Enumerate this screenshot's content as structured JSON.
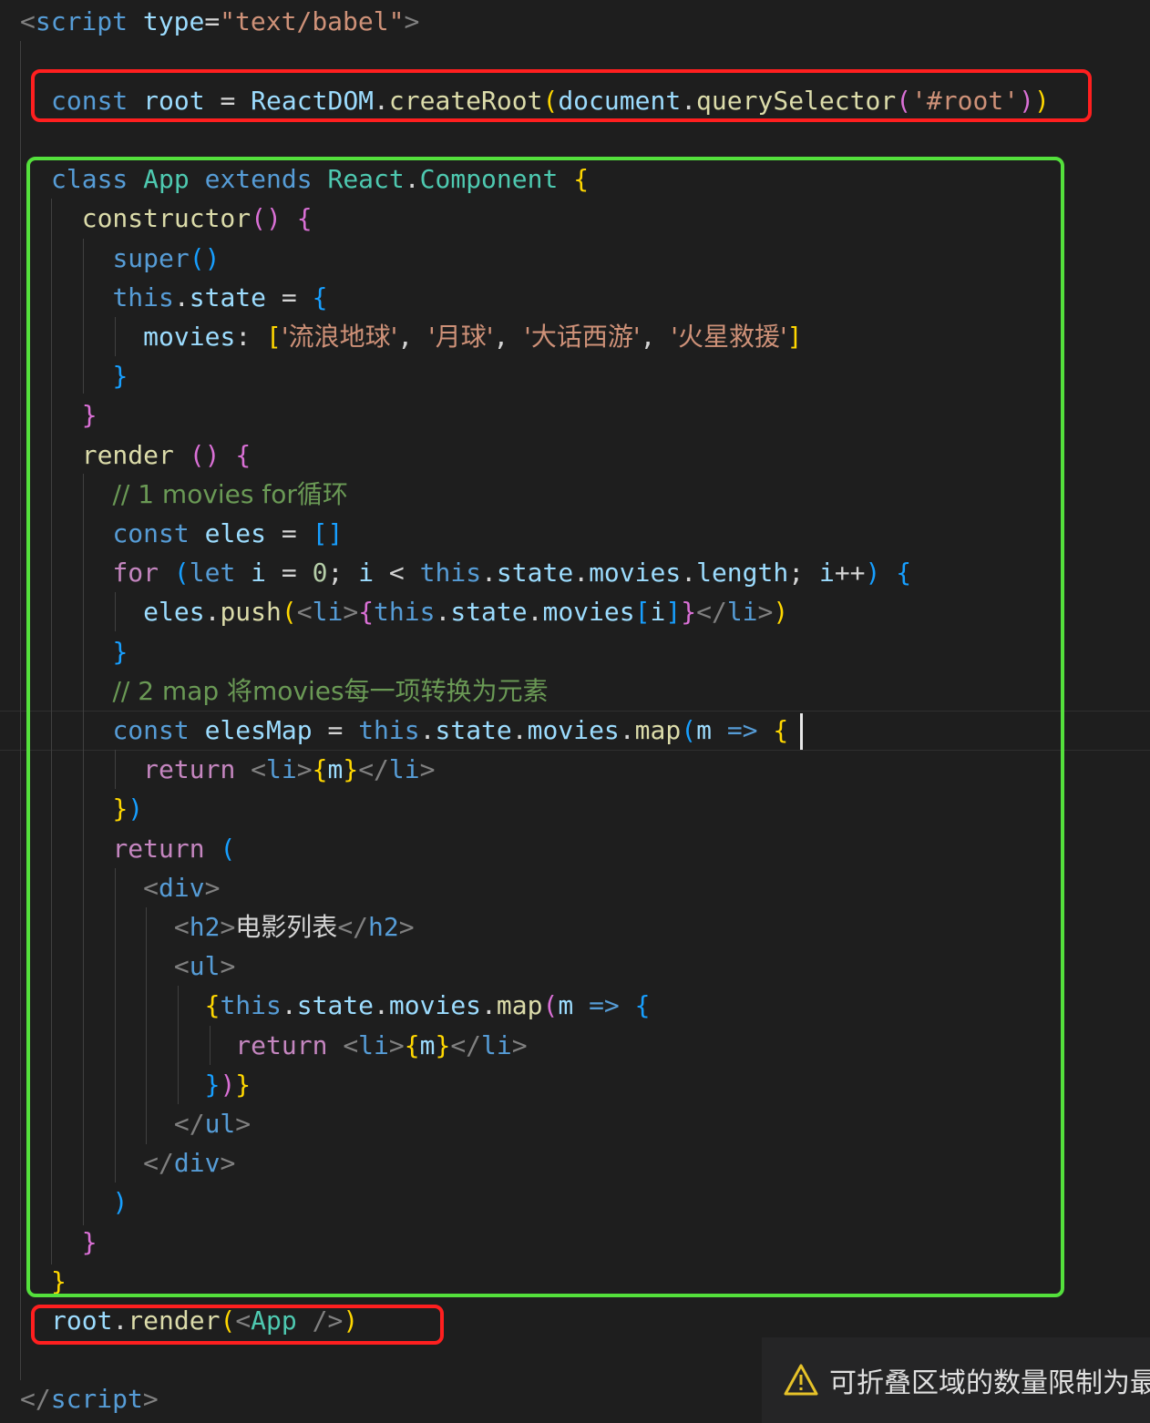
{
  "code": {
    "line1": [
      [
        "t-tag",
        "<"
      ],
      [
        "t-tagn",
        "script"
      ],
      [
        "t-txt",
        " "
      ],
      [
        "t-var",
        "type"
      ],
      [
        "t-txt",
        "="
      ],
      [
        "t-str",
        "\"text/babel\""
      ],
      [
        "t-tag",
        ">"
      ]
    ],
    "line2": [
      [
        "t-key",
        "const"
      ],
      [
        "t-txt",
        " "
      ],
      [
        "t-var",
        "root"
      ],
      [
        "t-txt",
        " = "
      ],
      [
        "t-var",
        "ReactDOM"
      ],
      [
        "t-txt",
        "."
      ],
      [
        "t-fn",
        "createRoot"
      ],
      [
        "t-br1",
        "("
      ],
      [
        "t-var",
        "document"
      ],
      [
        "t-txt",
        "."
      ],
      [
        "t-fn",
        "querySelector"
      ],
      [
        "t-br2",
        "("
      ],
      [
        "t-str",
        "'#root'"
      ],
      [
        "t-br2",
        ")"
      ],
      [
        "t-br1",
        ")"
      ]
    ],
    "line3": [
      [
        "t-key",
        "class"
      ],
      [
        "t-txt",
        " "
      ],
      [
        "t-cls",
        "App"
      ],
      [
        "t-txt",
        " "
      ],
      [
        "t-key",
        "extends"
      ],
      [
        "t-txt",
        " "
      ],
      [
        "t-cls",
        "React"
      ],
      [
        "t-txt",
        "."
      ],
      [
        "t-cls",
        "Component"
      ],
      [
        "t-txt",
        " "
      ],
      [
        "t-br1",
        "{"
      ]
    ],
    "line4": [
      [
        "t-txt",
        "  "
      ],
      [
        "t-fn",
        "constructor"
      ],
      [
        "t-br2",
        "()"
      ],
      [
        "t-txt",
        " "
      ],
      [
        "t-br2",
        "{"
      ]
    ],
    "line5": [
      [
        "t-txt",
        "    "
      ],
      [
        "t-key",
        "super"
      ],
      [
        "t-br3",
        "()"
      ]
    ],
    "line6": [
      [
        "t-txt",
        "    "
      ],
      [
        "t-key",
        "this"
      ],
      [
        "t-txt",
        "."
      ],
      [
        "t-var",
        "state"
      ],
      [
        "t-txt",
        " = "
      ],
      [
        "t-br3",
        "{"
      ]
    ],
    "line7": [
      [
        "t-txt",
        "      "
      ],
      [
        "t-var",
        "movies"
      ],
      [
        "t-txt",
        ": "
      ],
      [
        "t-br1",
        "["
      ],
      [
        "t-str",
        "'流浪地球'"
      ],
      [
        "t-txt",
        ", "
      ],
      [
        "t-str",
        "'月球'"
      ],
      [
        "t-txt",
        ", "
      ],
      [
        "t-str",
        "'大话西游'"
      ],
      [
        "t-txt",
        ", "
      ],
      [
        "t-str",
        "'火星救援'"
      ],
      [
        "t-br1",
        "]"
      ]
    ],
    "line8": [
      [
        "t-txt",
        "    "
      ],
      [
        "t-br3",
        "}"
      ]
    ],
    "line9": [
      [
        "t-txt",
        "  "
      ],
      [
        "t-br2",
        "}"
      ]
    ],
    "line10": [
      [
        "t-txt",
        "  "
      ],
      [
        "t-fn",
        "render"
      ],
      [
        "t-txt",
        " "
      ],
      [
        "t-br2",
        "()"
      ],
      [
        "t-txt",
        " "
      ],
      [
        "t-br2",
        "{"
      ]
    ],
    "line11": [
      [
        "t-txt",
        "    "
      ],
      [
        "t-com",
        "// 1 movies for循环"
      ]
    ],
    "line12": [
      [
        "t-txt",
        "    "
      ],
      [
        "t-key",
        "const"
      ],
      [
        "t-txt",
        " "
      ],
      [
        "t-var",
        "eles"
      ],
      [
        "t-txt",
        " = "
      ],
      [
        "t-br3",
        "[]"
      ]
    ],
    "line13": [
      [
        "t-txt",
        "    "
      ],
      [
        "t-ctl",
        "for"
      ],
      [
        "t-txt",
        " "
      ],
      [
        "t-br3",
        "("
      ],
      [
        "t-key",
        "let"
      ],
      [
        "t-txt",
        " "
      ],
      [
        "t-var",
        "i"
      ],
      [
        "t-txt",
        " = "
      ],
      [
        "t-num",
        "0"
      ],
      [
        "t-txt",
        "; "
      ],
      [
        "t-var",
        "i"
      ],
      [
        "t-txt",
        " < "
      ],
      [
        "t-key",
        "this"
      ],
      [
        "t-txt",
        "."
      ],
      [
        "t-var",
        "state"
      ],
      [
        "t-txt",
        "."
      ],
      [
        "t-var",
        "movies"
      ],
      [
        "t-txt",
        "."
      ],
      [
        "t-var",
        "length"
      ],
      [
        "t-txt",
        "; "
      ],
      [
        "t-var",
        "i"
      ],
      [
        "t-txt",
        "++"
      ],
      [
        "t-br3",
        ")"
      ],
      [
        "t-txt",
        " "
      ],
      [
        "t-br3",
        "{"
      ]
    ],
    "line14": [
      [
        "t-txt",
        "      "
      ],
      [
        "t-var",
        "eles"
      ],
      [
        "t-txt",
        "."
      ],
      [
        "t-fn",
        "push"
      ],
      [
        "t-br1",
        "("
      ],
      [
        "t-tag",
        "<"
      ],
      [
        "t-tagn",
        "li"
      ],
      [
        "t-tag",
        ">"
      ],
      [
        "t-br2",
        "{"
      ],
      [
        "t-key",
        "this"
      ],
      [
        "t-txt",
        "."
      ],
      [
        "t-var",
        "state"
      ],
      [
        "t-txt",
        "."
      ],
      [
        "t-var",
        "movies"
      ],
      [
        "t-br3",
        "["
      ],
      [
        "t-var",
        "i"
      ],
      [
        "t-br3",
        "]"
      ],
      [
        "t-br2",
        "}"
      ],
      [
        "t-tag",
        "</"
      ],
      [
        "t-tagn",
        "li"
      ],
      [
        "t-tag",
        ">"
      ],
      [
        "t-br1",
        ")"
      ]
    ],
    "line15": [
      [
        "t-txt",
        "    "
      ],
      [
        "t-br3",
        "}"
      ]
    ],
    "line16": [
      [
        "t-txt",
        "    "
      ],
      [
        "t-com",
        "// 2 map 将movies每一项转换为元素"
      ]
    ],
    "line17": [
      [
        "t-txt",
        "    "
      ],
      [
        "t-key",
        "const"
      ],
      [
        "t-txt",
        " "
      ],
      [
        "t-var",
        "elesMap"
      ],
      [
        "t-txt",
        " = "
      ],
      [
        "t-key",
        "this"
      ],
      [
        "t-txt",
        "."
      ],
      [
        "t-var",
        "state"
      ],
      [
        "t-txt",
        "."
      ],
      [
        "t-var",
        "movies"
      ],
      [
        "t-txt",
        "."
      ],
      [
        "t-fn",
        "map"
      ],
      [
        "t-br3",
        "("
      ],
      [
        "t-var",
        "m"
      ],
      [
        "t-txt",
        " "
      ],
      [
        "t-key",
        "=>"
      ],
      [
        "t-txt",
        " "
      ],
      [
        "t-br1",
        "{"
      ]
    ],
    "line18": [
      [
        "t-txt",
        "      "
      ],
      [
        "t-ctl",
        "return"
      ],
      [
        "t-txt",
        " "
      ],
      [
        "t-tag",
        "<"
      ],
      [
        "t-tagn",
        "li"
      ],
      [
        "t-tag",
        ">"
      ],
      [
        "t-br1",
        "{"
      ],
      [
        "t-var",
        "m"
      ],
      [
        "t-br1",
        "}"
      ],
      [
        "t-tag",
        "</"
      ],
      [
        "t-tagn",
        "li"
      ],
      [
        "t-tag",
        ">"
      ]
    ],
    "line19": [
      [
        "t-txt",
        "    "
      ],
      [
        "t-br1",
        "}"
      ],
      [
        "t-br3",
        ")"
      ]
    ],
    "line20": [
      [
        "t-txt",
        "    "
      ],
      [
        "t-ctl",
        "return"
      ],
      [
        "t-txt",
        " "
      ],
      [
        "t-br3",
        "("
      ]
    ],
    "line21": [
      [
        "t-txt",
        "      "
      ],
      [
        "t-tag",
        "<"
      ],
      [
        "t-tagn",
        "div"
      ],
      [
        "t-tag",
        ">"
      ]
    ],
    "line22": [
      [
        "t-txt",
        "        "
      ],
      [
        "t-tag",
        "<"
      ],
      [
        "t-tagn",
        "h2"
      ],
      [
        "t-tag",
        ">"
      ],
      [
        "t-txt",
        "电影列表"
      ],
      [
        "t-tag",
        "</"
      ],
      [
        "t-tagn",
        "h2"
      ],
      [
        "t-tag",
        ">"
      ]
    ],
    "line23": [
      [
        "t-txt",
        "        "
      ],
      [
        "t-tag",
        "<"
      ],
      [
        "t-tagn",
        "ul"
      ],
      [
        "t-tag",
        ">"
      ]
    ],
    "line24": [
      [
        "t-txt",
        "          "
      ],
      [
        "t-br1",
        "{"
      ],
      [
        "t-key",
        "this"
      ],
      [
        "t-txt",
        "."
      ],
      [
        "t-var",
        "state"
      ],
      [
        "t-txt",
        "."
      ],
      [
        "t-var",
        "movies"
      ],
      [
        "t-txt",
        "."
      ],
      [
        "t-fn",
        "map"
      ],
      [
        "t-br2",
        "("
      ],
      [
        "t-var",
        "m"
      ],
      [
        "t-txt",
        " "
      ],
      [
        "t-key",
        "=>"
      ],
      [
        "t-txt",
        " "
      ],
      [
        "t-br3",
        "{"
      ]
    ],
    "line25": [
      [
        "t-txt",
        "            "
      ],
      [
        "t-ctl",
        "return"
      ],
      [
        "t-txt",
        " "
      ],
      [
        "t-tag",
        "<"
      ],
      [
        "t-tagn",
        "li"
      ],
      [
        "t-tag",
        ">"
      ],
      [
        "t-br1",
        "{"
      ],
      [
        "t-var",
        "m"
      ],
      [
        "t-br1",
        "}"
      ],
      [
        "t-tag",
        "</"
      ],
      [
        "t-tagn",
        "li"
      ],
      [
        "t-tag",
        ">"
      ]
    ],
    "line26": [
      [
        "t-txt",
        "          "
      ],
      [
        "t-br3",
        "}"
      ],
      [
        "t-br2",
        ")"
      ],
      [
        "t-br1",
        "}"
      ]
    ],
    "line27": [
      [
        "t-txt",
        "        "
      ],
      [
        "t-tag",
        "</"
      ],
      [
        "t-tagn",
        "ul"
      ],
      [
        "t-tag",
        ">"
      ]
    ],
    "line28": [
      [
        "t-txt",
        "      "
      ],
      [
        "t-tag",
        "</"
      ],
      [
        "t-tagn",
        "div"
      ],
      [
        "t-tag",
        ">"
      ]
    ],
    "line29": [
      [
        "t-txt",
        "    "
      ],
      [
        "t-br3",
        ")"
      ]
    ],
    "line30": [
      [
        "t-txt",
        "  "
      ],
      [
        "t-br2",
        "}"
      ]
    ],
    "line31": [
      [
        "t-br1",
        "}"
      ]
    ],
    "line32": [
      [
        "t-var",
        "root"
      ],
      [
        "t-txt",
        "."
      ],
      [
        "t-fn",
        "render"
      ],
      [
        "t-br1",
        "("
      ],
      [
        "t-tag",
        "<"
      ],
      [
        "t-cls",
        "App"
      ],
      [
        "t-txt",
        " "
      ],
      [
        "t-tag",
        "/>"
      ],
      [
        "t-br1",
        ")"
      ]
    ],
    "line33": [
      [
        "t-tag",
        "</"
      ],
      [
        "t-tagn",
        "script"
      ],
      [
        "t-tag",
        ">"
      ]
    ]
  },
  "notification": {
    "icon": "warning-icon",
    "text": "可折叠区域的数量限制为最"
  },
  "colors": {
    "red_box": "#ff1f1f",
    "green_box": "#54e03c",
    "background": "#1e1e1e"
  }
}
